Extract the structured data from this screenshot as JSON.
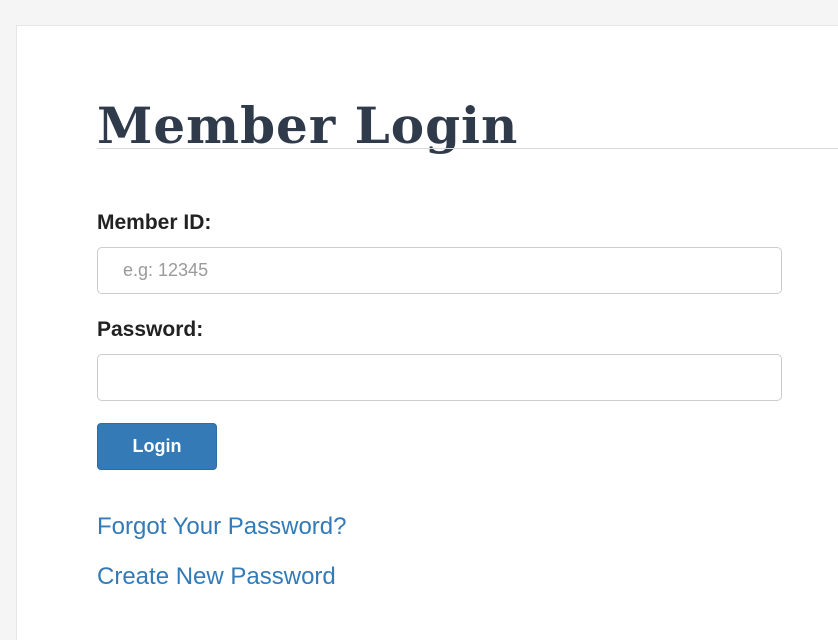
{
  "login_form": {
    "title": "Member Login",
    "member_id_label": "Member ID:",
    "member_id_placeholder": "e.g: 12345",
    "member_id_value": "",
    "password_label": "Password:",
    "password_value": "",
    "login_button_label": "Login",
    "forgot_password_link": "Forgot Your Password?",
    "create_password_link": "Create New Password"
  },
  "colors": {
    "accent": "#337ab7",
    "title": "#2f3a4b",
    "background": "#f5f5f5",
    "panel": "#ffffff"
  }
}
